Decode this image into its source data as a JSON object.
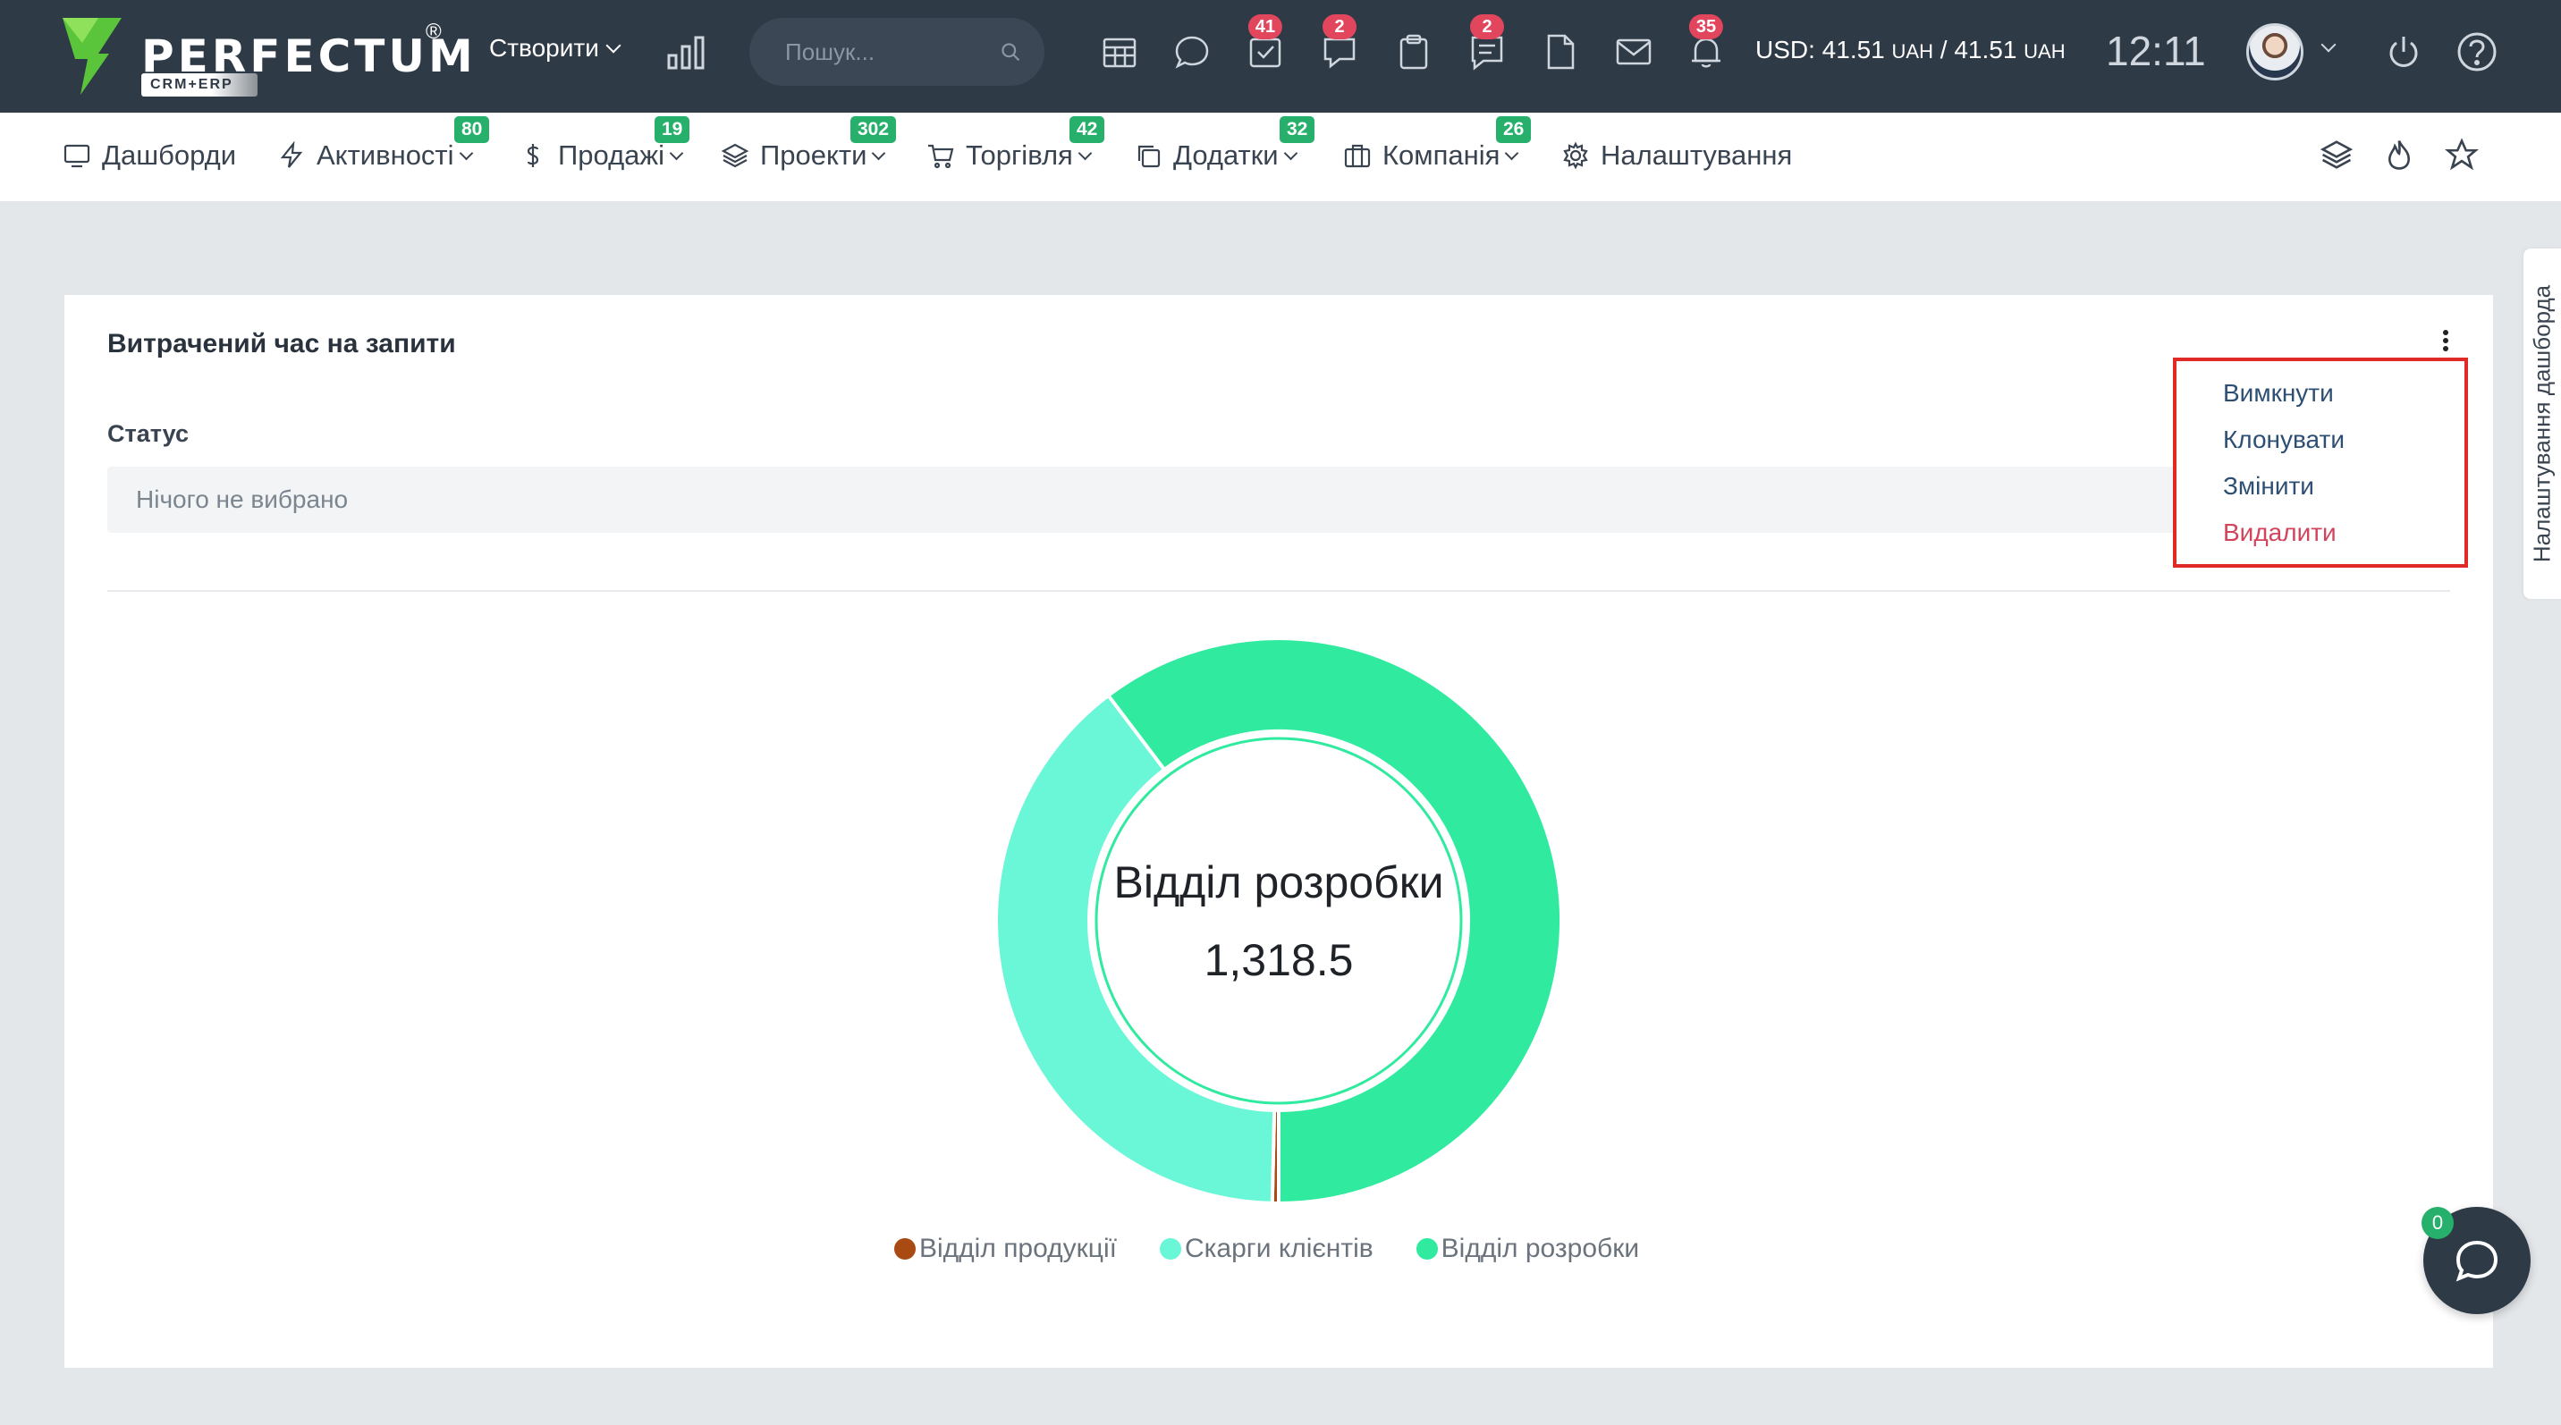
{
  "topbar": {
    "logo_text": "PERFECTUM",
    "logo_sub": "CRM+ERP",
    "logo_reg": "®",
    "create_label": "Створити",
    "search_placeholder": "Пошук...",
    "badges": {
      "tasks": "41",
      "chat": "2",
      "notes": "2",
      "notifications": "35"
    },
    "currency_main": "USD: 41.51 ",
    "currency_unit1": "UAH",
    "currency_sep": " / 41.51 ",
    "currency_unit2": "UAH",
    "time": "12:11"
  },
  "nav": {
    "items": [
      {
        "label": "Дашборди",
        "icon": "dashboard-icon"
      },
      {
        "label": "Активності",
        "badge": "80",
        "icon": "bolt-icon"
      },
      {
        "label": "Продажі",
        "badge": "19",
        "icon": "dollar-icon"
      },
      {
        "label": "Проекти",
        "badge": "302",
        "icon": "layers-icon"
      },
      {
        "label": "Торгівля",
        "badge": "42",
        "icon": "cart-icon"
      },
      {
        "label": "Додатки",
        "badge": "32",
        "icon": "copy-icon"
      },
      {
        "label": "Компанія",
        "badge": "26",
        "icon": "briefcase-icon"
      },
      {
        "label": "Налаштування",
        "icon": "gear-icon"
      }
    ]
  },
  "widget": {
    "title": "Витрачений час на запити",
    "status_label": "Статус",
    "status_value": "Нічого не вибрано",
    "menu": [
      "Вимкнути",
      "Клонувати",
      "Змінити",
      "Видалити"
    ]
  },
  "side_tab": "Налаштування дашборда",
  "chat_badge": "0",
  "colors": {
    "accent_green": "#27b06b",
    "badge_red": "#e2465d",
    "topbar": "#2f3a47",
    "highlight": "#e02a28"
  },
  "chart_data": {
    "type": "pie",
    "title": "",
    "categories": [
      "Відділ продукції",
      "Скарги клієнтів",
      "Відділ розробки"
    ],
    "values": [
      8,
      860,
      1318.5
    ],
    "colors": [
      "#a84a12",
      "#69f7d8",
      "#30eb9f"
    ],
    "center_label": "Відділ розробки",
    "center_value": "1,318.5",
    "legend_position": "bottom"
  }
}
